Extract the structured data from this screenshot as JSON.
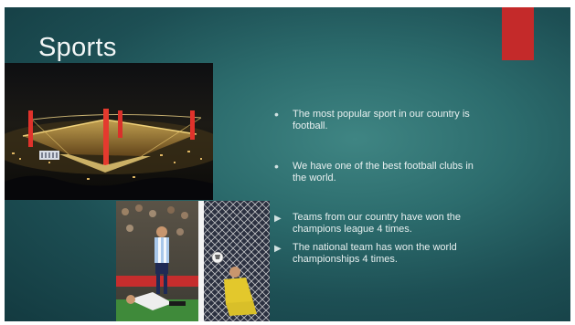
{
  "slide": {
    "title": "Sports",
    "accent_color": "#c42a2a",
    "bullets": [
      {
        "marker": "•",
        "text": "The most popular sport in our country is football."
      },
      {
        "marker": "•",
        "text": "We have one of the best football clubs in the world."
      },
      {
        "marker": "▶",
        "text": "Teams from our country have won the champions league 4 times."
      },
      {
        "marker": "▶",
        "text": "The national team has won the world championships 4 times."
      }
    ]
  },
  "icons": {
    "photo_1": "stadium-night-photo",
    "photo_2": "football-match-photo"
  }
}
